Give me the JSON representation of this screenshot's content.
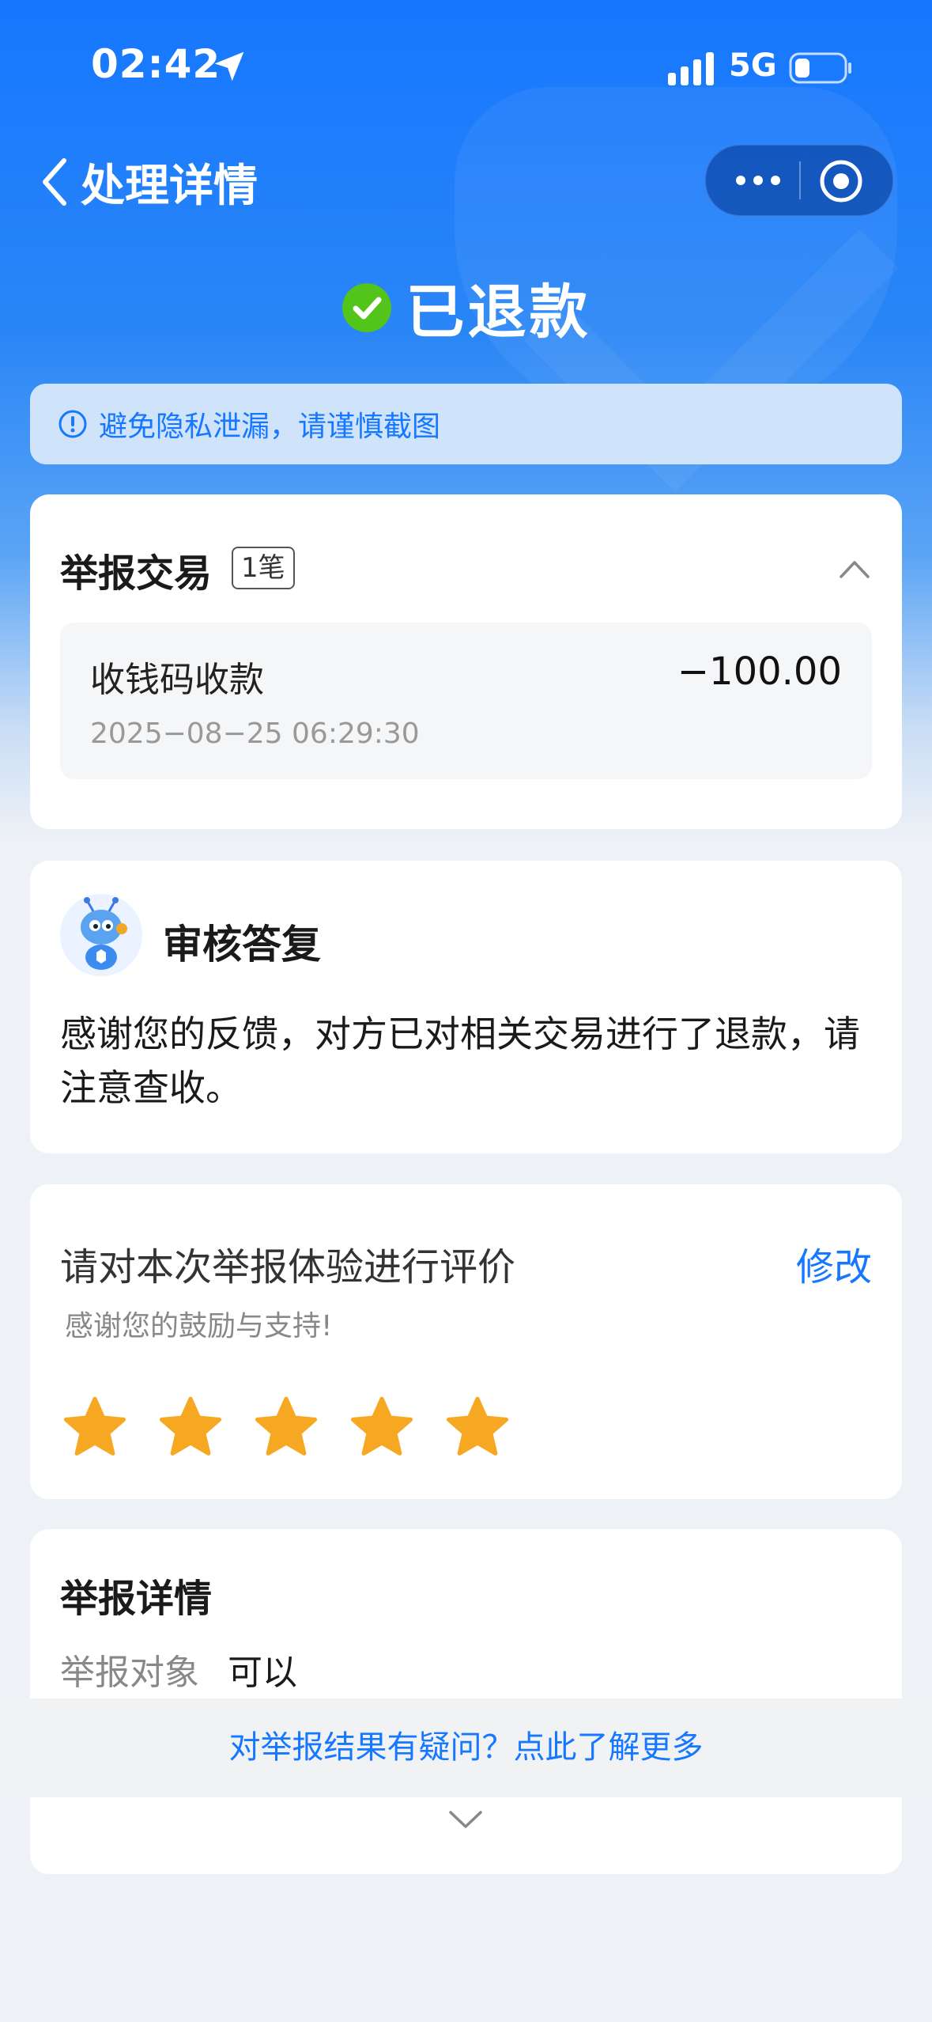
{
  "status_bar": {
    "time": "02:42",
    "network": "5G"
  },
  "nav": {
    "title": "处理详情"
  },
  "status": {
    "text": "已退款"
  },
  "notice": {
    "text": "避免隐私泄漏，请谨慎截图"
  },
  "report_transaction": {
    "title": "举报交易",
    "count_badge": "1笔",
    "item": {
      "name": "收钱码收款",
      "amount": "−100.00",
      "datetime": "2025−08−25 06:29:30"
    }
  },
  "review_reply": {
    "title": "审核答复",
    "body": "感谢您的反馈，对方已对相关交易进行了退款，请注意查收。"
  },
  "rating": {
    "title": "请对本次举报体验进行评价",
    "edit_label": "修改",
    "subtitle": "感谢您的鼓励与支持!",
    "stars": 5,
    "star_color": "#f7a823"
  },
  "report_details": {
    "title": "举报详情",
    "rows": [
      {
        "label": "举报对象",
        "value": "可以"
      }
    ]
  },
  "help_link": {
    "text": "对举报结果有疑问？点此了解更多"
  },
  "colors": {
    "accent": "#1677ff",
    "success": "#52c41a",
    "background": "#eef1f6"
  }
}
